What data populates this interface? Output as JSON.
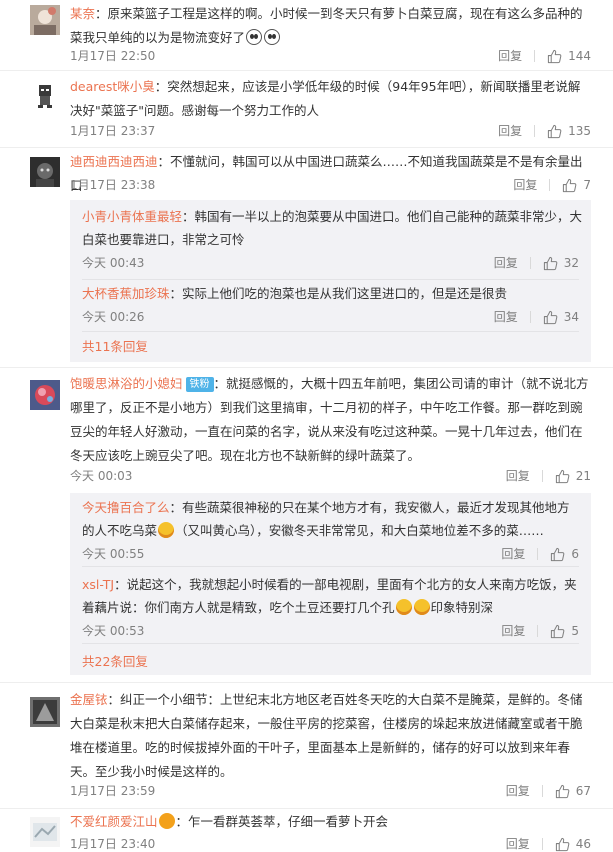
{
  "comments": [
    {
      "username": "某奈",
      "text": "：原来菜篮子工程是这样的啊。小时候一到冬天只有萝卜白菜豆腐，现在有这么多品种的菜我只单纯的以为是物流变好了",
      "time": "1月17日 22:50",
      "reply_label": "回复",
      "likes": "144"
    },
    {
      "username": "dearest咪小臭",
      "text": "：突然想起来，应该是小学低年级的时候（94年95年吧），新闻联播里老说解决好\"菜篮子\"问题。感谢每一个努力工作的人",
      "time": "1月17日 23:37",
      "reply_label": "回复",
      "likes": "135"
    },
    {
      "username": "迪西迪西迪西迪",
      "text": "：不懂就问，韩国可以从中国进口蔬菜么……不知道我国蔬菜是不是有余量出口",
      "time": "1月17日 23:38",
      "reply_label": "回复",
      "likes": "7",
      "replies": [
        {
          "username": "小青小青体重最轻",
          "text": "：韩国有一半以上的泡菜要从中国进口。他们自己能种的蔬菜非常少，大白菜也要靠进口，非常之可怜",
          "time": "今天 00:43",
          "reply_label": "回复",
          "likes": "32"
        },
        {
          "username": "大杯香蕉加珍珠",
          "text": "：实际上他们吃的泡菜也是从我们这里进口的，但是还是很贵",
          "time": "今天 00:26",
          "reply_label": "回复",
          "likes": "34"
        }
      ],
      "more_label": "共11条回复"
    },
    {
      "username": "饱暖思淋浴的小媳妇",
      "badge": "铁粉",
      "text": "：就挺感慨的，大概十四五年前吧，集团公司请的审计（就不说北方哪里了，反正不是小地方）到我们这里搞审，十二月初的样子，中午吃工作餐。那一群吃到豌豆尖的年轻人好激动，一直在问菜的名字，说从来没有吃过这种菜。一晃十几年过去，他们在冬天应该吃上豌豆尖了吧。现在北方也不缺新鲜的绿叶蔬菜了。",
      "time": "今天 00:03",
      "reply_label": "回复",
      "likes": "21",
      "replies": [
        {
          "username": "今天撸百合了么",
          "text_a": "：有些蔬菜很神秘的只在某个地方才有，我安徽人，最近才发现其他地方的人不吃乌菜",
          "text_b": "（又叫黄心乌），安徽冬天非常常见，和大白菜地位差不多的菜……",
          "time": "今天 00:55",
          "reply_label": "回复",
          "likes": "6"
        },
        {
          "username": "xsl-TJ",
          "text_a": "：说起这个，我就想起小时候看的一部电视剧，里面有个北方的女人来南方吃饭，夹着藕片说：你们南方人就是精致，吃个土豆还要打几个孔",
          "text_b": "印象特别深",
          "time": "今天 00:53",
          "reply_label": "回复",
          "likes": "5"
        }
      ],
      "more_label": "共22条回复"
    },
    {
      "username": "金屋铱",
      "text": "：纠正一个小细节：上世纪末北方地区老百姓冬天吃的大白菜不是腌菜，是鲜的。冬储大白菜是秋末把大白菜储存起来，一般住平房的挖菜窖，住楼房的垛起来放进储藏室或者干脆堆在楼道里。吃的时候拔掉外面的干叶子，里面基本上是新鲜的，储存的好可以放到来年春天。至少我小时候是这样的。",
      "time": "1月17日 23:59",
      "reply_label": "回复",
      "likes": "67"
    },
    {
      "username": "不爱红颜爱江山",
      "text": "：乍一看群英荟萃，仔细一看萝卜开会",
      "time": "1月17日 23:40",
      "reply_label": "回复",
      "likes": "46"
    }
  ],
  "icons": {
    "like": "thumbs-up-icon",
    "emoji_panda": "panda-emoji-icon",
    "emoji_laugh_cry": "laughing-crying-emoji-icon",
    "emoji_vip": "vip-emoji-icon"
  },
  "colors": {
    "username": "#eb7350",
    "meta": "#808080",
    "reply_box_bg": "#f2f2f5",
    "badge": "#4fb3e8"
  }
}
